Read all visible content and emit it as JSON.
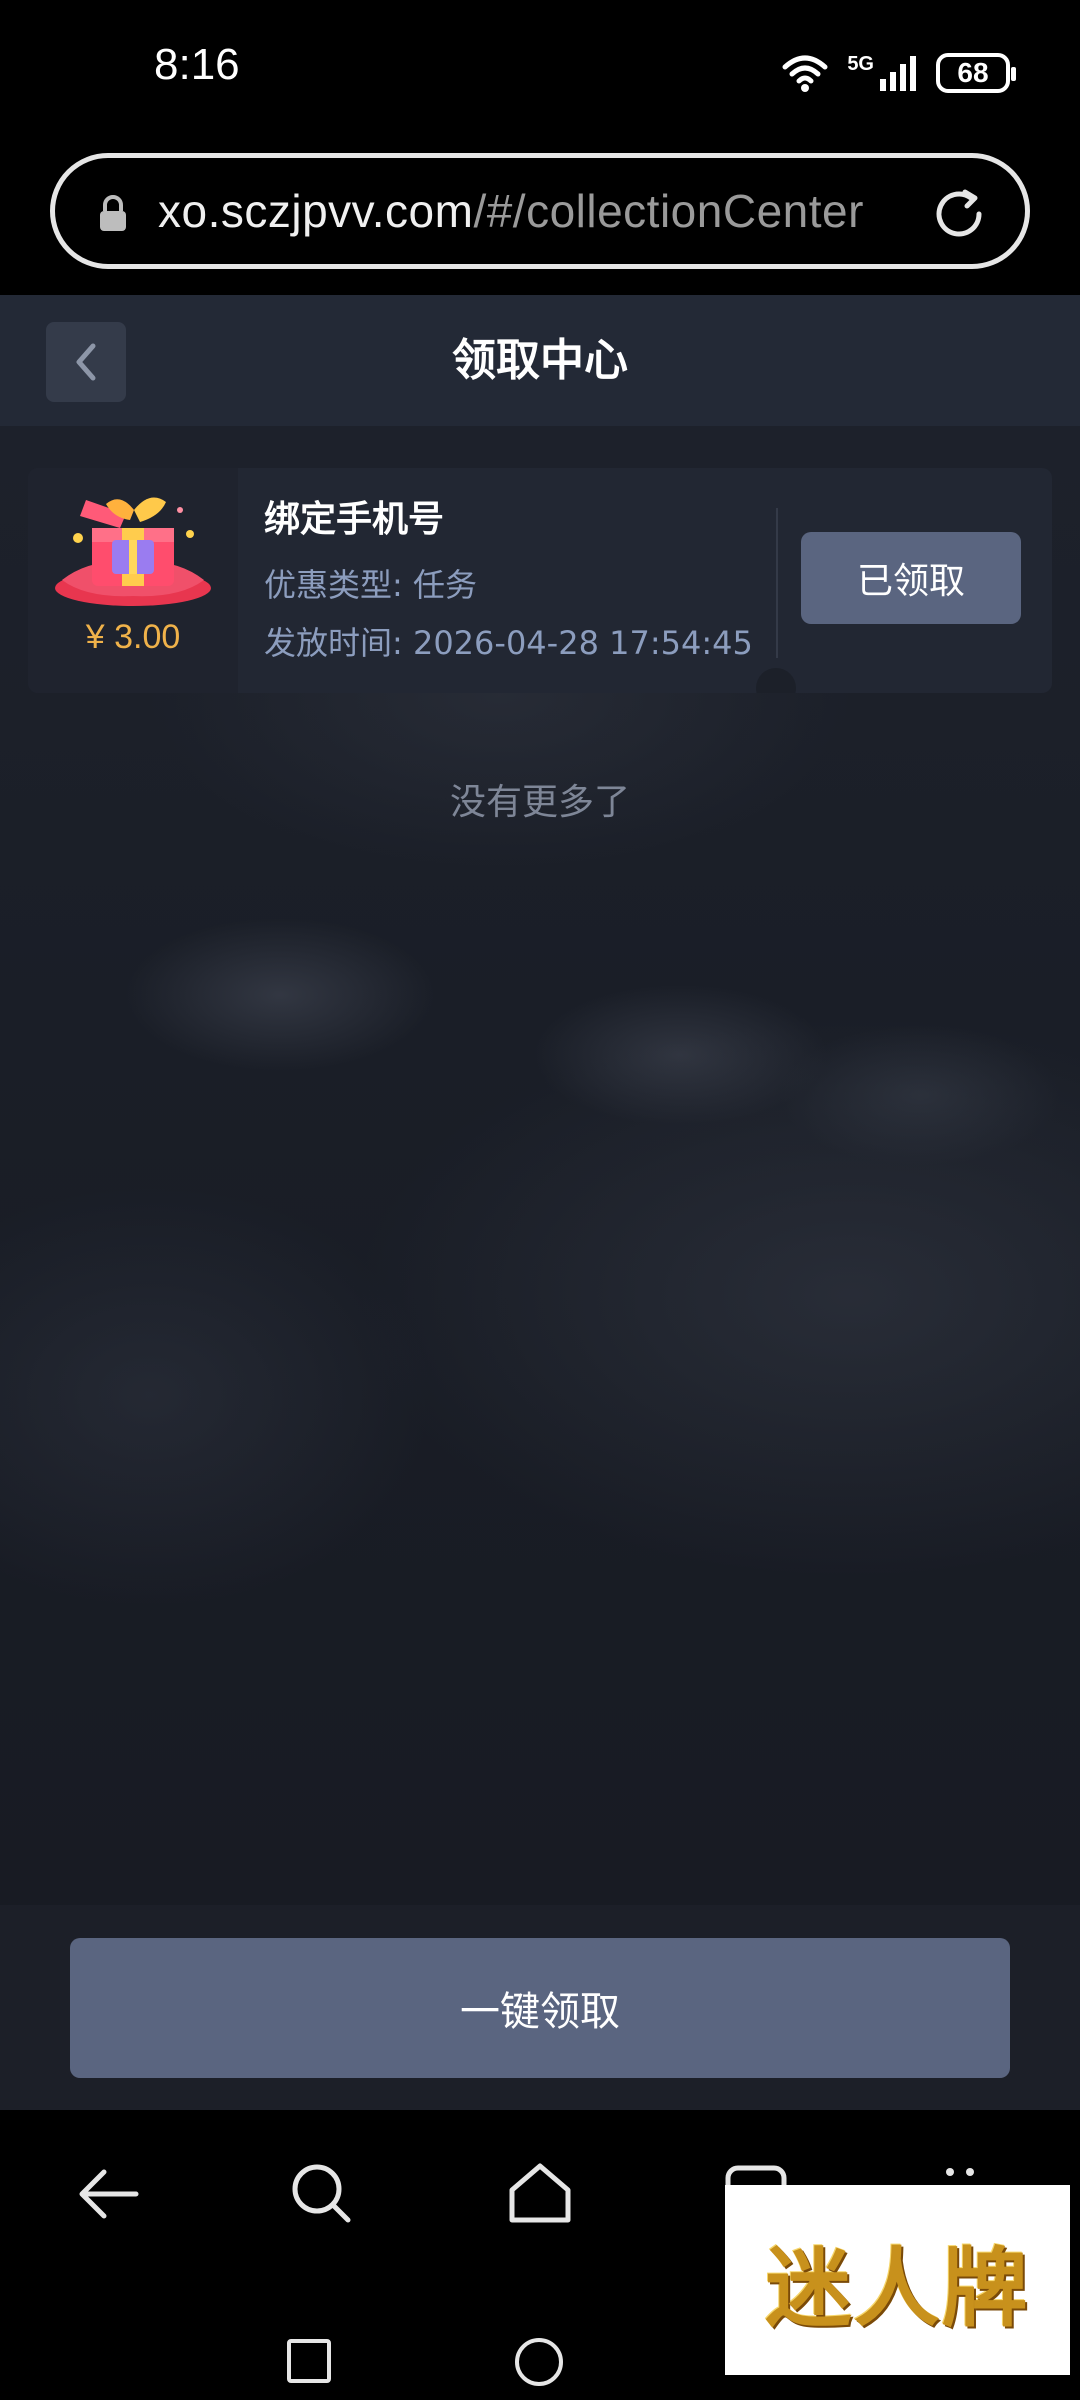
{
  "status_bar": {
    "time": "8:16",
    "network": "5G",
    "battery": "68"
  },
  "browser": {
    "url_domain": "xo.sczjpvv.com",
    "url_path": "/#/collectionCenter"
  },
  "header": {
    "title": "领取中心"
  },
  "reward": {
    "amount": "¥ 3.00",
    "title": "绑定手机号",
    "type_line": "优惠类型: 任务",
    "time_line": "发放时间: 2026-04-28 17:54:45",
    "status_button": "已领取"
  },
  "list_end_text": "没有更多了",
  "claim_all_button": "一键领取",
  "watermark": "迷人牌",
  "colors": {
    "header_bg": "#232936",
    "card_bg": "#222733",
    "button_bg": "#5a6580",
    "amount": "#f0b24a",
    "secondary_text": "#8c9dbe"
  }
}
